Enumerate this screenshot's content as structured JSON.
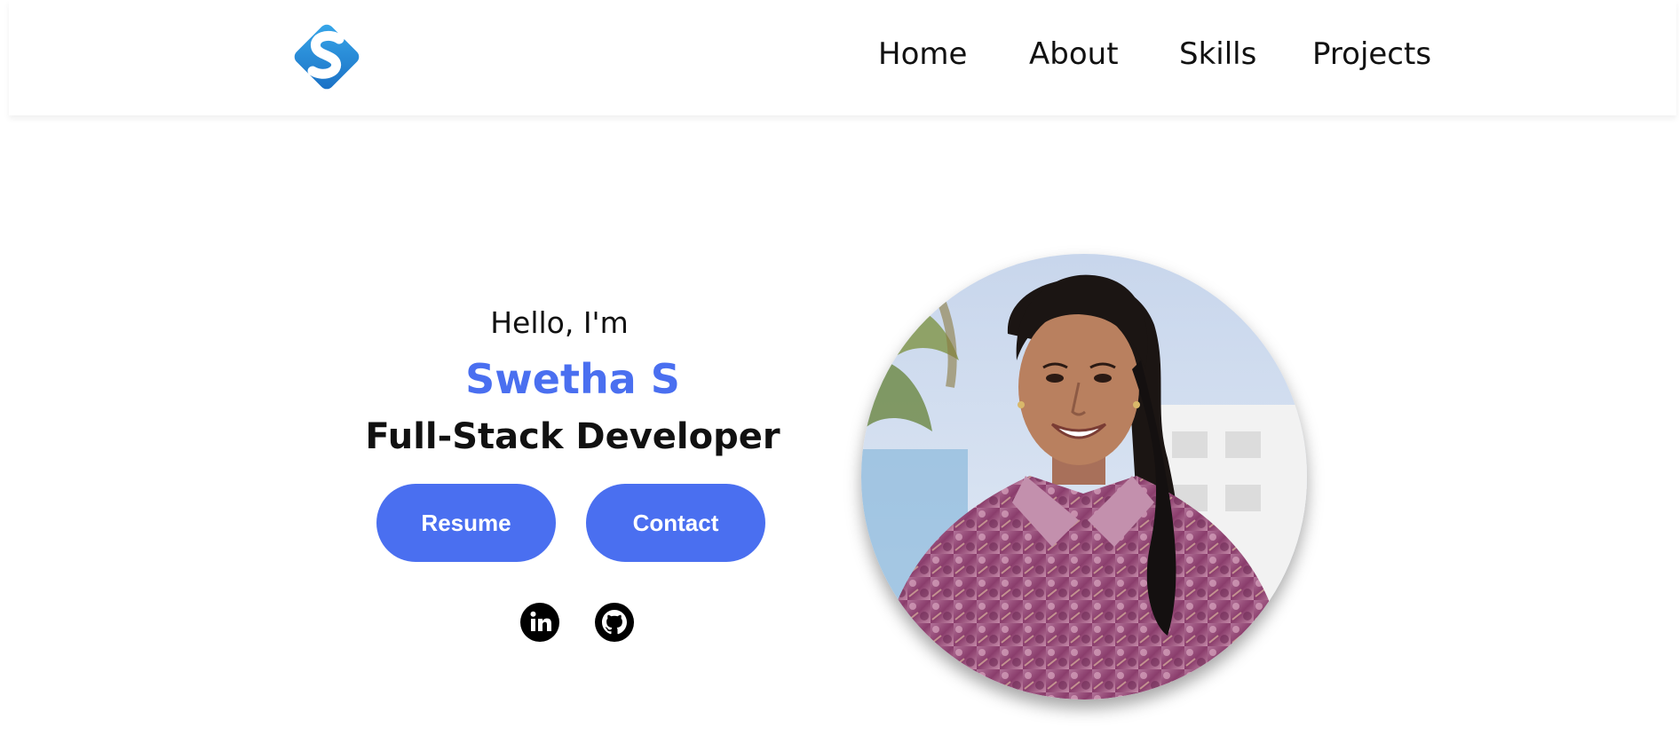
{
  "nav": {
    "items": [
      {
        "label": "Home"
      },
      {
        "label": "About"
      },
      {
        "label": "Skills"
      },
      {
        "label": "Projects"
      }
    ]
  },
  "hero": {
    "greeting": "Hello, I'm",
    "name": "Swetha S",
    "role": "Full-Stack Developer",
    "buttons": {
      "resume": "Resume",
      "contact": "Contact"
    }
  },
  "colors": {
    "accent": "#4a6ff0",
    "text": "#111111",
    "background": "#ffffff"
  },
  "icons": {
    "logo": "s-logo-icon",
    "social": [
      "linkedin-icon",
      "github-icon"
    ]
  }
}
